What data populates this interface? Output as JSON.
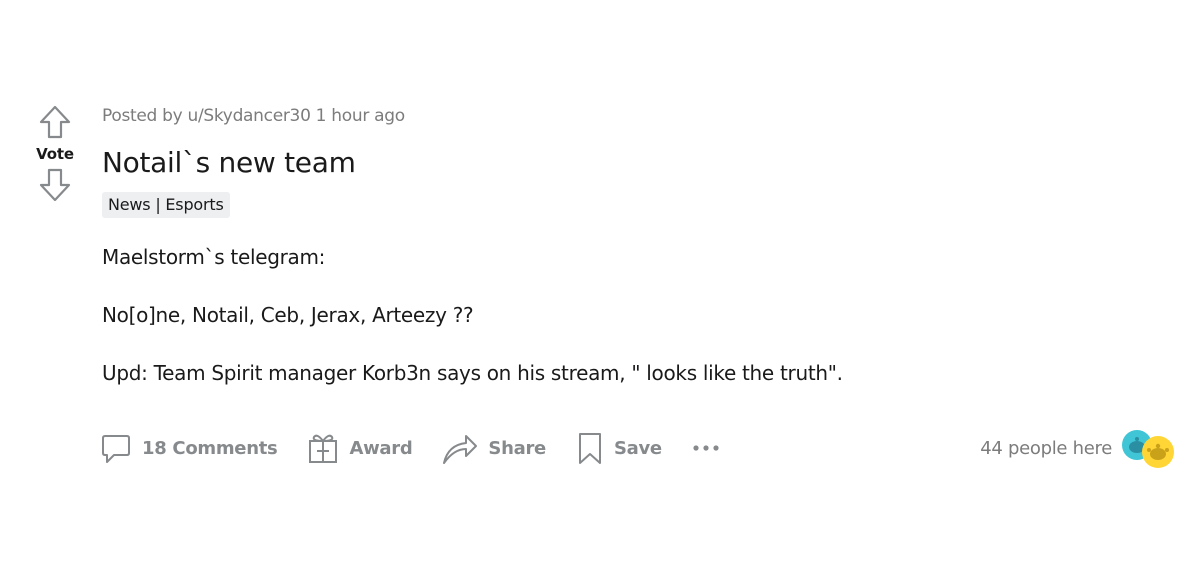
{
  "vote": {
    "label": "Vote"
  },
  "post": {
    "meta": "Posted by u/Skydancer30 1 hour ago",
    "title": "Notail`s new team",
    "flair": "News | Esports",
    "body": [
      "Maelstorm`s telegram:",
      "No[o]ne, Notail, Ceb, Jerax, Arteezy ??",
      "Upd: Team Spirit manager Korb3n says on his stream, \" looks like the truth\"."
    ]
  },
  "actions": {
    "comments": "18 Comments",
    "award": "Award",
    "share": "Share",
    "save": "Save",
    "more_icon": "ellipsis-icon"
  },
  "presence": {
    "text": "44 people here",
    "avatar_colors": [
      "#24a0ed",
      "#ffd635"
    ]
  },
  "colors": {
    "text_primary": "#1a1a1b",
    "text_meta": "#7c7c7c",
    "action_gray": "#878a8c",
    "flair_bg": "#edeff1"
  }
}
